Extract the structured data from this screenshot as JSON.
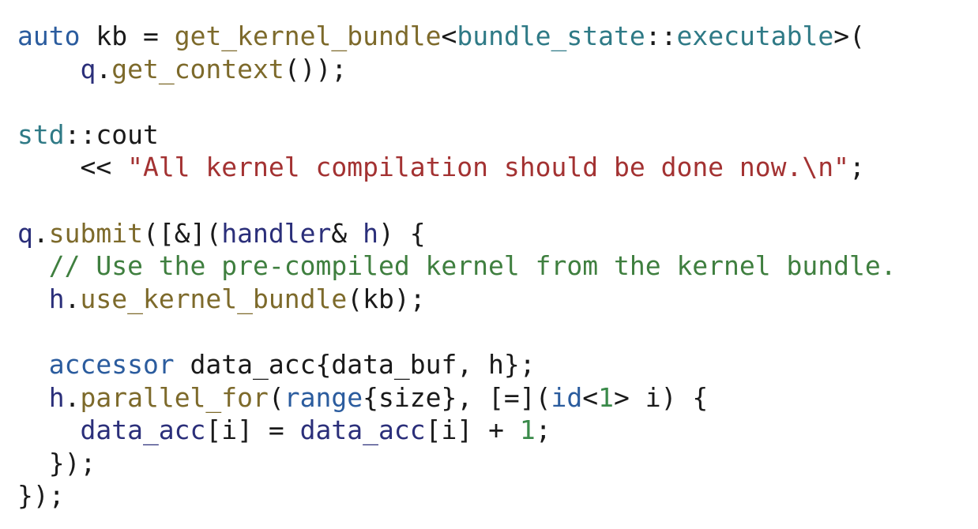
{
  "colors": {
    "keyword": "#2b5c9e",
    "function": "#7d6a2b",
    "type": "#2f7a86",
    "string": "#a33232",
    "comment": "#3f7f3f",
    "identifier": "#2b2f7a",
    "number": "#3a8a4a",
    "plain": "#1a1a1a"
  },
  "code": {
    "lines": [
      [
        {
          "t": "auto",
          "k": "kw"
        },
        {
          "t": " kb = ",
          "k": "plain"
        },
        {
          "t": "get_kernel_bundle",
          "k": "fn"
        },
        {
          "t": "<",
          "k": "plain"
        },
        {
          "t": "bundle_state",
          "k": "ty"
        },
        {
          "t": "::",
          "k": "plain"
        },
        {
          "t": "executable",
          "k": "ty"
        },
        {
          "t": ">(",
          "k": "plain"
        }
      ],
      [
        {
          "t": "    q",
          "k": "id"
        },
        {
          "t": ".",
          "k": "plain"
        },
        {
          "t": "get_context",
          "k": "fn"
        },
        {
          "t": "());",
          "k": "plain"
        }
      ],
      [],
      [
        {
          "t": "std",
          "k": "ty"
        },
        {
          "t": "::cout",
          "k": "plain"
        }
      ],
      [
        {
          "t": "    << ",
          "k": "plain"
        },
        {
          "t": "\"All kernel compilation should be done now.\\n\"",
          "k": "str"
        },
        {
          "t": ";",
          "k": "plain"
        }
      ],
      [],
      [
        {
          "t": "q",
          "k": "id"
        },
        {
          "t": ".",
          "k": "plain"
        },
        {
          "t": "submit",
          "k": "fn"
        },
        {
          "t": "([&](",
          "k": "plain"
        },
        {
          "t": "handler",
          "k": "id"
        },
        {
          "t": "& ",
          "k": "plain"
        },
        {
          "t": "h",
          "k": "id"
        },
        {
          "t": ") {",
          "k": "plain"
        }
      ],
      [
        {
          "t": "  // Use the pre-compiled kernel from the kernel bundle.",
          "k": "cmt"
        }
      ],
      [
        {
          "t": "  h",
          "k": "id"
        },
        {
          "t": ".",
          "k": "plain"
        },
        {
          "t": "use_kernel_bundle",
          "k": "fn"
        },
        {
          "t": "(kb);",
          "k": "plain"
        }
      ],
      [],
      [
        {
          "t": "  accessor",
          "k": "kw"
        },
        {
          "t": " data_acc{data_buf, h};",
          "k": "plain"
        }
      ],
      [
        {
          "t": "  h",
          "k": "id"
        },
        {
          "t": ".",
          "k": "plain"
        },
        {
          "t": "parallel_for",
          "k": "fn"
        },
        {
          "t": "(",
          "k": "plain"
        },
        {
          "t": "range",
          "k": "kw"
        },
        {
          "t": "{size}, [=](",
          "k": "plain"
        },
        {
          "t": "id",
          "k": "kw"
        },
        {
          "t": "<",
          "k": "plain"
        },
        {
          "t": "1",
          "k": "num"
        },
        {
          "t": "> i) {",
          "k": "plain"
        }
      ],
      [
        {
          "t": "    data_acc",
          "k": "id"
        },
        {
          "t": "[i] = ",
          "k": "plain"
        },
        {
          "t": "data_acc",
          "k": "id"
        },
        {
          "t": "[i] + ",
          "k": "plain"
        },
        {
          "t": "1",
          "k": "num"
        },
        {
          "t": ";",
          "k": "plain"
        }
      ],
      [
        {
          "t": "  });",
          "k": "plain"
        }
      ],
      [
        {
          "t": "});",
          "k": "plain"
        }
      ]
    ]
  }
}
